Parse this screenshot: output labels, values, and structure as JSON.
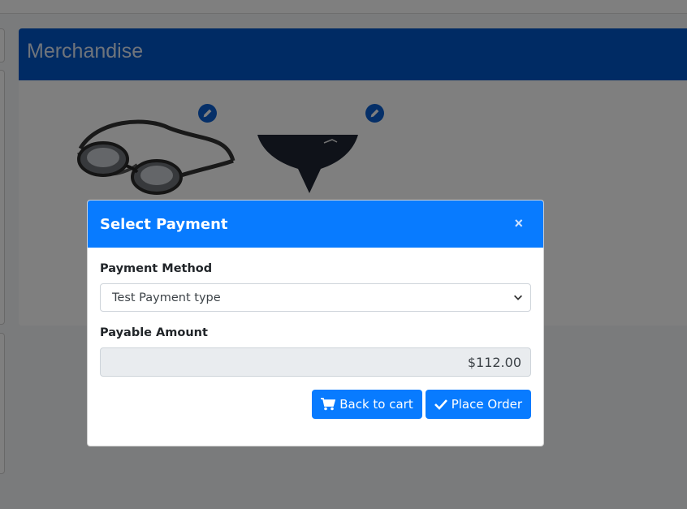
{
  "card": {
    "title": "Merchandise"
  },
  "products": [
    {
      "name": "goggles",
      "icon": "goggles-image"
    },
    {
      "name": "swim-brief",
      "icon": "swim-brief-image"
    }
  ],
  "modal": {
    "title": "Select Payment",
    "close_symbol": "×",
    "payment_method": {
      "label": "Payment Method",
      "selected": "Test Payment type"
    },
    "payable_amount": {
      "label": "Payable Amount",
      "value": "$112.00"
    },
    "buttons": {
      "back": "Back to cart",
      "place": "Place Order"
    }
  },
  "colors": {
    "card_header": "#0057c8",
    "modal_header": "#087bff",
    "button": "#087bff",
    "amount_bg": "#e9ecef"
  }
}
